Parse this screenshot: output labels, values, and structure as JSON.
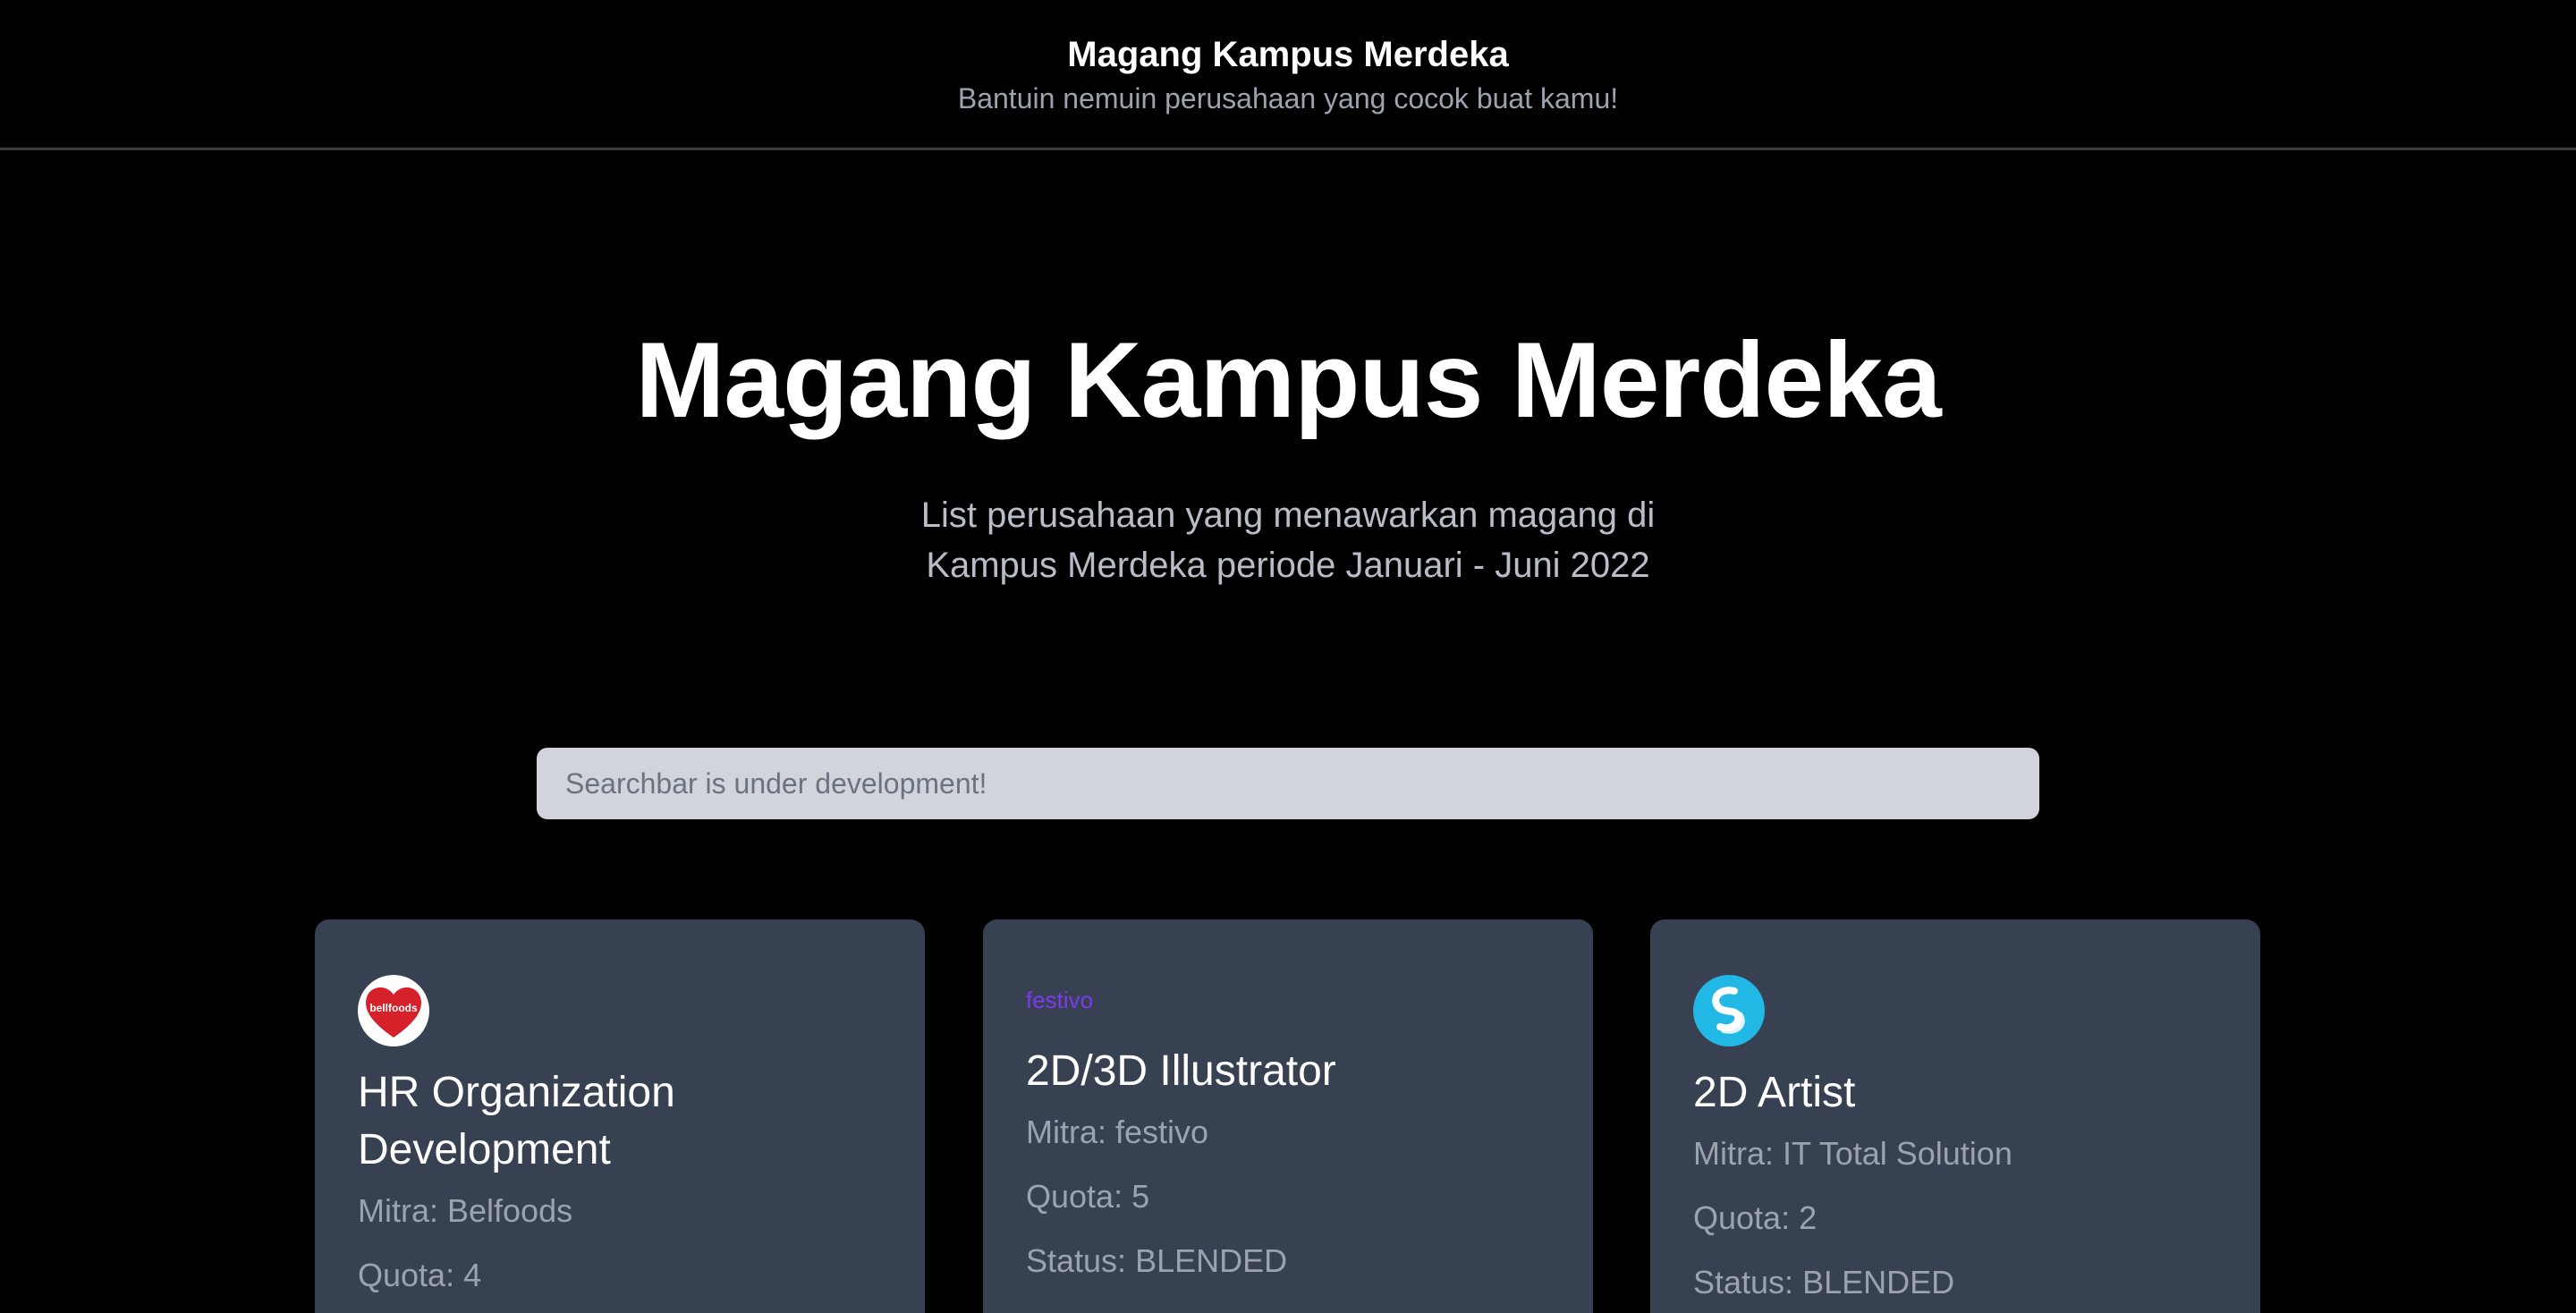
{
  "header": {
    "title": "Magang Kampus Merdeka",
    "subtitle": "Bantuin nemuin perusahaan yang cocok buat kamu!"
  },
  "hero": {
    "title": "Magang Kampus Merdeka",
    "description_line1": "List perusahaan yang menawarkan magang di",
    "description_line2": "Kampus Merdeka periode Januari - Juni 2022"
  },
  "search": {
    "placeholder": "Searchbar is under development!"
  },
  "cards": [
    {
      "logo": "belfoods-logo",
      "logo_text": "bellfoods",
      "title": "HR Organization Development",
      "mitra": "Mitra: Belfoods",
      "quota": "Quota: 4"
    },
    {
      "logo": "festivo-logo",
      "logo_text": "festivo",
      "title": "2D/3D Illustrator",
      "mitra": "Mitra: festivo",
      "quota": "Quota: 5",
      "status": "Status: BLENDED"
    },
    {
      "logo": "it-total-solution-logo",
      "title": "2D Artist",
      "mitra": "Mitra: IT Total Solution",
      "quota": "Quota: 2",
      "status": "Status: BLENDED"
    }
  ],
  "colors": {
    "background": "#000000",
    "card": "#374151",
    "search_bg": "#d1d5db",
    "muted_text": "#9ca3af",
    "belfoods_red": "#d6202a",
    "its_blue": "#22b8e6"
  }
}
